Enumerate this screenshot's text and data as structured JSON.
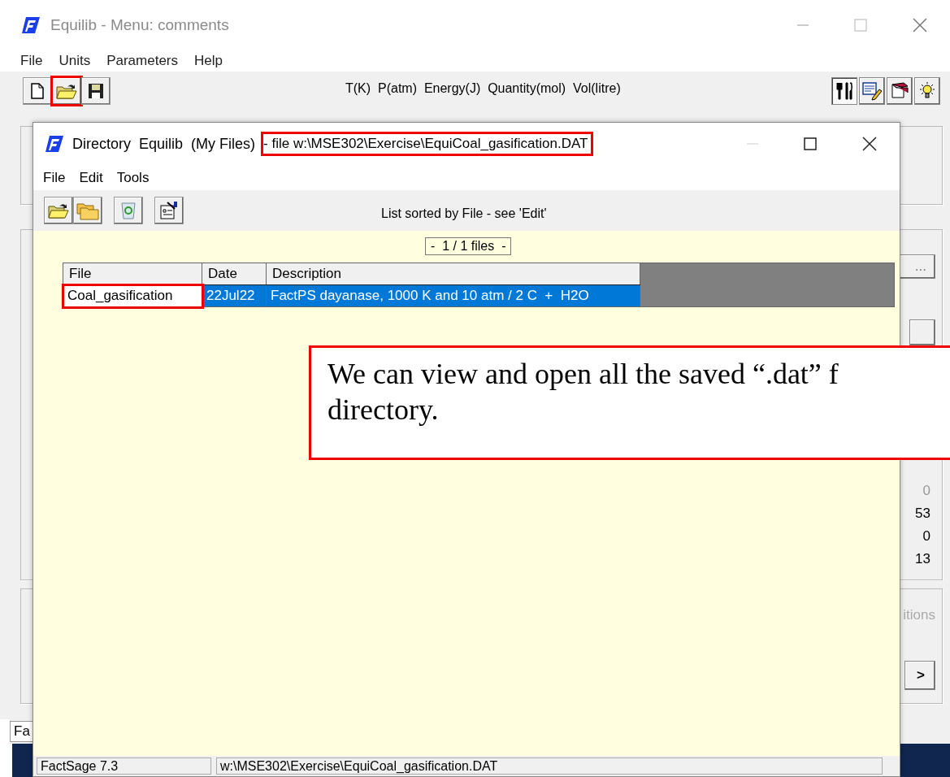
{
  "main_window": {
    "title": "Equilib - Menu: comments",
    "active": false,
    "menu": [
      "File",
      "Units",
      "Parameters",
      "Help"
    ],
    "toolbar": [
      {
        "highlighted": false
      },
      {
        "highlighted": true
      },
      {
        "highlighted": false
      }
    ],
    "units": "T(K)  P(atm)  Energy(J)  Quantity(mol)  Vol(litre)",
    "tool_buttons": [
      {
        "pressed": true
      },
      {
        "pressed": false
      },
      {
        "pressed": false
      },
      {
        "pressed": false
      }
    ],
    "side_button": "...",
    "values": [
      {
        "text": "0",
        "disabled": true
      },
      {
        "text": "53",
        "disabled": false
      },
      {
        "text": "0",
        "disabled": false
      },
      {
        "text": "13",
        "disabled": false
      }
    ],
    "conditions_label": "itions",
    "next_button": ">",
    "status": "Fa"
  },
  "dialog": {
    "title": "Directory  Equilib  (My Files)",
    "title_file": "- file w:\\MSE302\\Exercise\\EquiCoal_gasification.DAT",
    "title_file_highlighted": true,
    "menu": [
      "File",
      "Edit",
      "Tools"
    ],
    "sort_note": "List sorted by File - see 'Edit'",
    "counter": "-  1 / 1 files  -",
    "columns": [
      "File",
      "Date",
      "Description"
    ],
    "rows": [
      {
        "file": "Coal_gasification",
        "date": "22Jul22",
        "description": "FactPS dayanase, 1000 K and 10 atm / 2 C  +  H2O",
        "selected": true,
        "file_highlighted": true
      }
    ],
    "status": [
      "FactSage 7.3",
      "w:\\MSE302\\Exercise\\EquiCoal_gasification.DAT"
    ]
  },
  "note": {
    "lines": [
      "We can view and open all the saved “.dat” f",
      "directory."
    ]
  }
}
